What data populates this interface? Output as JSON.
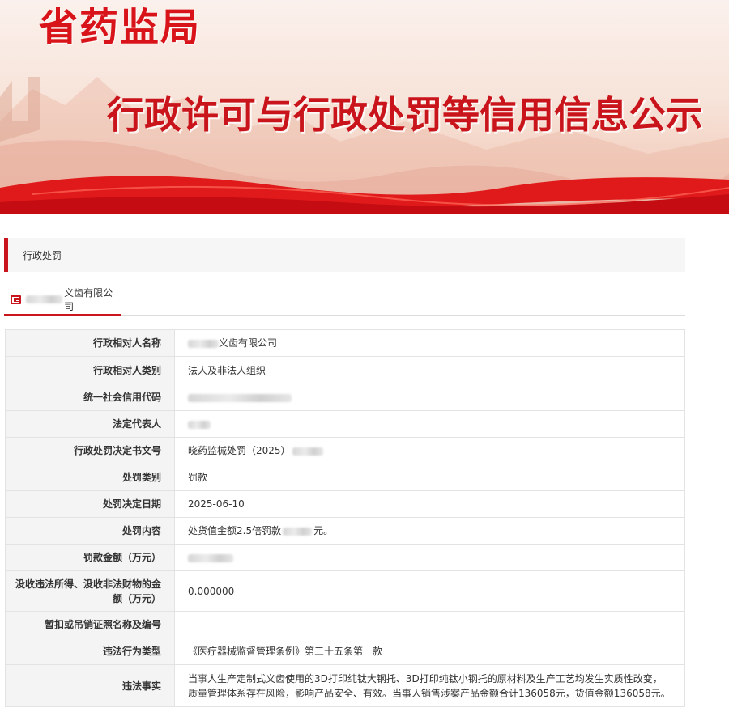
{
  "banner": {
    "agency": "省药监局",
    "headline": "行政许可与行政处罚等信用信息公示",
    "colors": {
      "red": "#d8141a",
      "accent": "#c9151e"
    }
  },
  "section": {
    "title": "行政处罚"
  },
  "tab": {
    "icon": "id-card-icon",
    "name_suffix": "义齿有限公司"
  },
  "rows": [
    {
      "key": "行政相对人名称",
      "value": "义齿有限公司"
    },
    {
      "key": "行政相对人类别",
      "value": "法人及非法人组织"
    },
    {
      "key": "统一社会信用代码",
      "value": ""
    },
    {
      "key": "法定代表人",
      "value": ""
    },
    {
      "key": "行政处罚决定书文号",
      "value": "晓药监械处罚（2025）"
    },
    {
      "key": "处罚类别",
      "value": "罚款"
    },
    {
      "key": "处罚决定日期",
      "value": "2025-06-10"
    },
    {
      "key": "处罚内容",
      "value_a": "处货值金额2.5倍罚款",
      "value_b": "元。"
    },
    {
      "key": "罚款金额（万元）",
      "value": ""
    },
    {
      "key": "没收违法所得、没收非法财物的金额（万元）",
      "value": "0.000000"
    },
    {
      "key": "暂扣或吊销证照名称及编号",
      "value": ""
    },
    {
      "key": "违法行为类型",
      "value": "《医疗器械监督管理条例》第三十五条第一款"
    },
    {
      "key": "违法事实",
      "value": "当事人生产定制式义齿使用的3D打印纯钛大钢托、3D打印纯钛小钢托的原材料及生产工艺均发生实质性改变，质量管理体系存在风险，影响产品安全、有效。当事人销售涉案产品金额合计136058元，货值金额136058元。"
    }
  ]
}
